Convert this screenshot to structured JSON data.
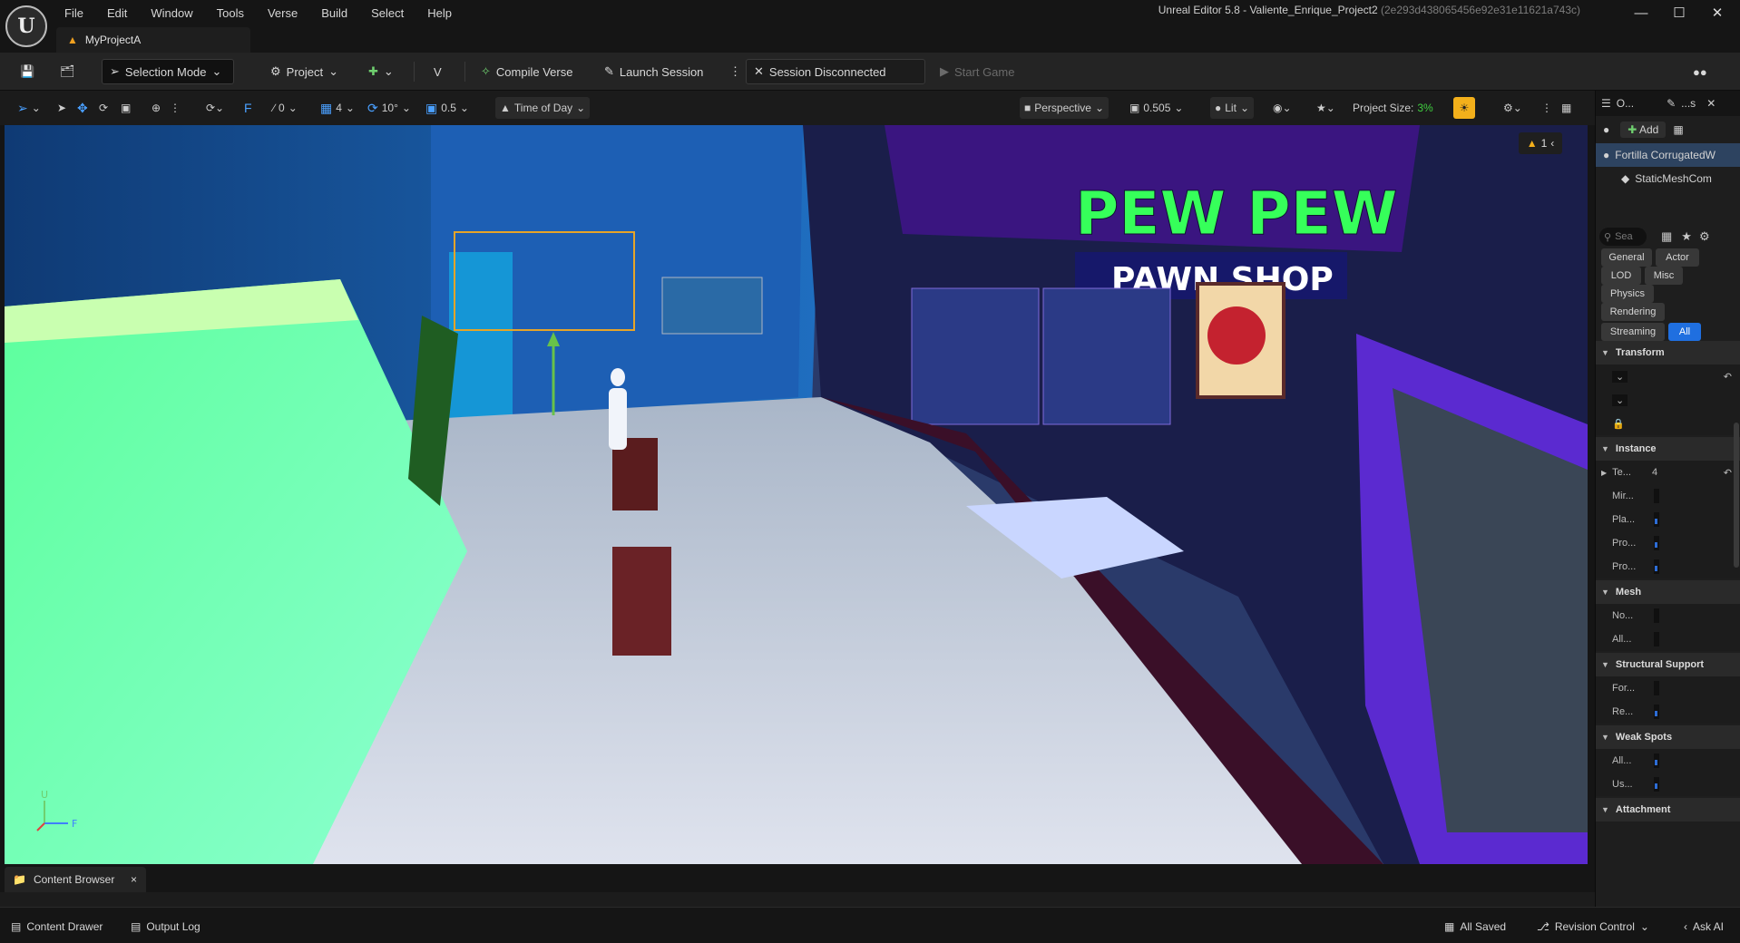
{
  "menu": [
    "File",
    "Edit",
    "Window",
    "Tools",
    "Verse",
    "Build",
    "Select",
    "Help"
  ],
  "window": {
    "title": "Unreal Editor 5.8 - Valiente_Enrique_Project2",
    "hash": "(2e293d438065456e92e31e11621a743c)"
  },
  "project_tab": "MyProjectA",
  "toolbar": {
    "selection_mode": "Selection Mode",
    "project": "Project",
    "compile_verse": "Compile Verse",
    "launch_session": "Launch Session",
    "session_status": "Session Disconnected",
    "start_game": "Start Game"
  },
  "viewport_toolbar": {
    "rotate_snap": "0",
    "grid_count": "4",
    "angle_snap": "10°",
    "scale_snap": "0.5",
    "time_of_day": "Time of Day",
    "perspective": "Perspective",
    "screen_pct": "0.505",
    "lit": "Lit",
    "project_size_label": "Project Size:",
    "project_size_value": "3%"
  },
  "viewport": {
    "warning_count": "1",
    "sign_main": "PEW PEW",
    "sign_sub": "PAWN SHOP",
    "axis_up": "U",
    "axis_fwd": "F"
  },
  "outliner": {
    "tab1": "O...",
    "tab2": "...s",
    "add": "Add",
    "selected_actor": "Fortilla CorrugatedW",
    "component": "StaticMeshCom",
    "search_placeholder": "Sea"
  },
  "filters": [
    "General",
    "Actor",
    "LOD",
    "Misc",
    "Physics",
    "Rendering",
    "Streaming",
    "All"
  ],
  "details": {
    "cat_transform": "Transform",
    "cat_instance": "Instance",
    "prop_te": "Te...",
    "prop_te_value": "4",
    "prop_mir": "Mir...",
    "prop_pla": "Pla...",
    "prop_pro1": "Pro...",
    "prop_pro2": "Pro...",
    "cat_mesh": "Mesh",
    "prop_no": "No...",
    "prop_all1": "All...",
    "cat_structural": "Structural Support",
    "prop_for": "For...",
    "prop_re": "Re...",
    "cat_weak": "Weak Spots",
    "prop_all2": "All...",
    "prop_us": "Us...",
    "cat_attachment": "Attachment"
  },
  "content_browser": {
    "tab": "Content Browser",
    "close": "×"
  },
  "status": {
    "content_drawer": "Content Drawer",
    "output_log": "Output Log",
    "all_saved": "All Saved",
    "revision_control": "Revision Control",
    "ask_ai": "Ask AI"
  },
  "colors": {
    "accent": "#1f6fe0",
    "warning": "#f3b01b",
    "project_size": "#3fcf3f"
  }
}
